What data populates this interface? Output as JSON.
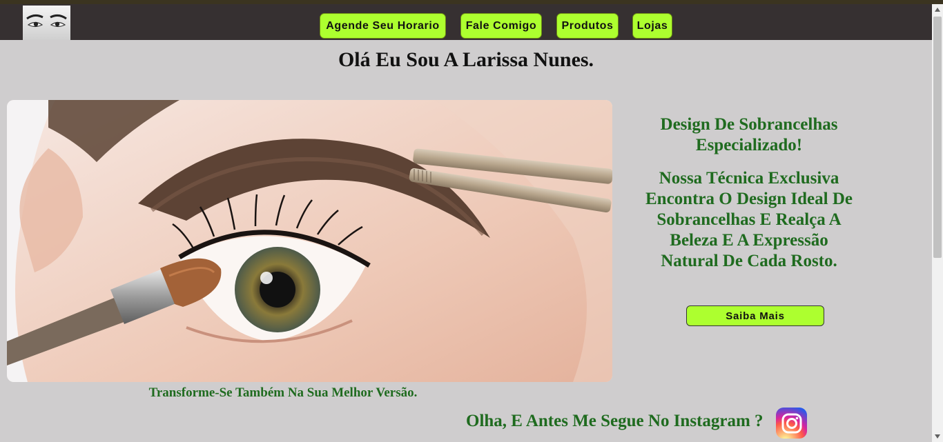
{
  "header": {
    "logo_icon": "eyebrows-logo-icon",
    "nav": [
      {
        "label": "Agende Seu Horario"
      },
      {
        "label": "Fale Comigo"
      },
      {
        "label": "Produtos"
      },
      {
        "label": "Lojas"
      }
    ]
  },
  "main": {
    "title": "Olá Eu Sou A Larissa Nunes.",
    "hero_image_icon": "eyebrow-makeup-photo",
    "caption": "Transforme-Se Também Na Sua Melhor Versão.",
    "side": {
      "heading": "Design De Sobrancelhas Especializado!",
      "paragraph": "Nossa Técnica Exclusiva Encontra O Design Ideal De Sobrancelhas E Realça A Beleza E A Expressão Natural De Cada Rosto.",
      "button_label": "Saiba Mais"
    },
    "instagram": {
      "text": "Olha, E Antes Me Segue No Instagram ?",
      "icon": "instagram-icon"
    }
  },
  "colors": {
    "page_bg": "#cfcdce",
    "navbar_bg": "#363031",
    "button_accent": "#adff2f",
    "text_green": "#1f6b1f"
  }
}
